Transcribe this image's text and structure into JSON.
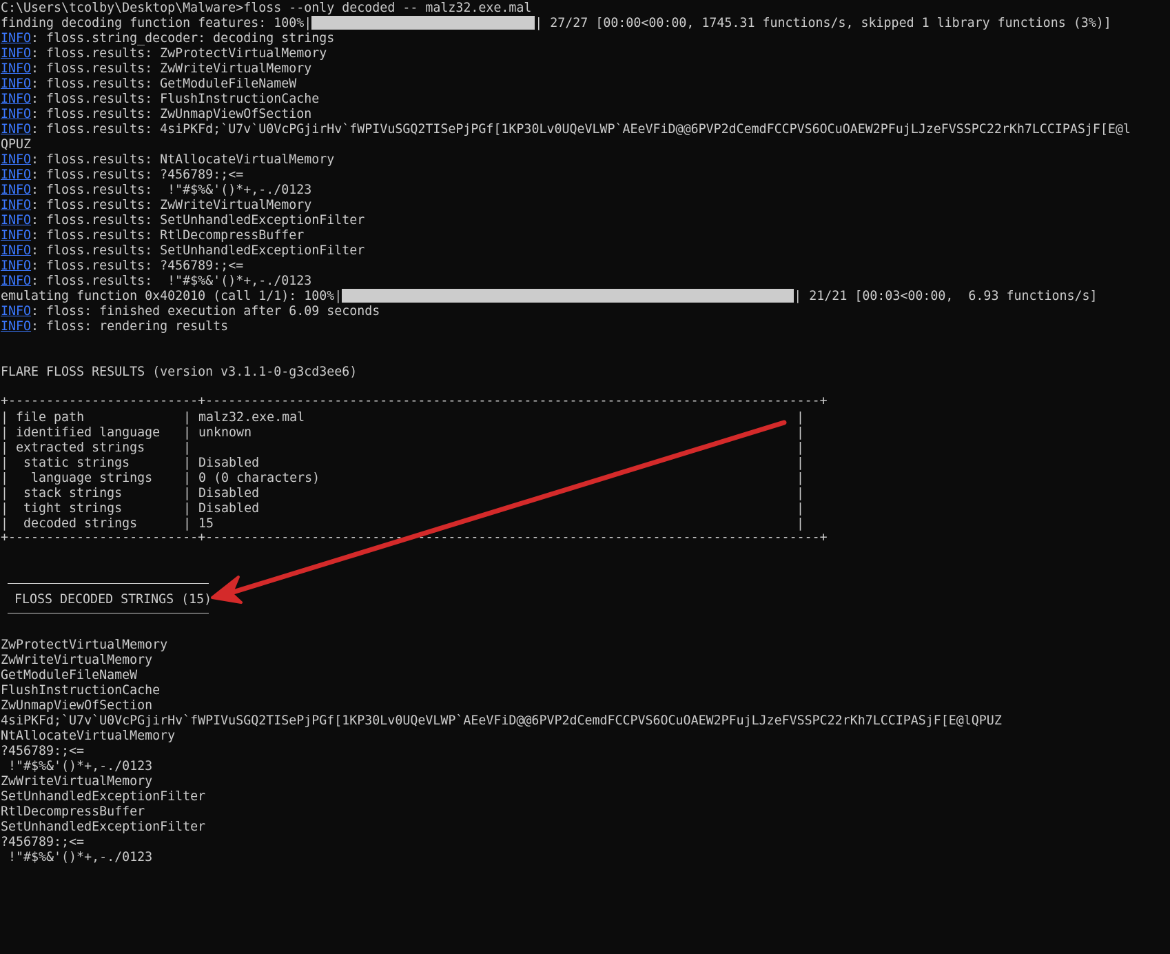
{
  "command_line": "C:\\Users\\tcolby\\Desktop\\Malware>floss --only decoded -- malz32.exe.mal",
  "progress1": {
    "prefix": "finding decoding function features: 100%|",
    "percent": 100,
    "suffix": "| 27/27 [00:00<00:00, 1745.31 functions/s, skipped 1 library functions (3%)]"
  },
  "info_tag": "INFO",
  "log_lines": [
    ": floss.string_decoder: decoding strings",
    ": floss.results: ZwProtectVirtualMemory",
    ": floss.results: ZwWriteVirtualMemory",
    ": floss.results: GetModuleFileNameW",
    ": floss.results: FlushInstructionCache",
    ": floss.results: ZwUnmapViewOfSection",
    ": floss.results: 4siPKFd;`U7v`U0VcPGjirHv`fWPIVuSGQ2TISePjPGf[1KP30Lv0UQeVLWP`AEeVFiD@@6PVP2dCemdFCCPVS6OCuOAEW2PFujLJzeFVSSPC22rKh7LCCIPASjF[E@l",
    ": floss.results: NtAllocateVirtualMemory",
    ": floss.results: ?456789:;<=",
    ": floss.results:  !\"#$%&'()*+,-./0123",
    ": floss.results: ZwWriteVirtualMemory",
    ": floss.results: SetUnhandledExceptionFilter",
    ": floss.results: RtlDecompressBuffer",
    ": floss.results: SetUnhandledExceptionFilter",
    ": floss.results: ?456789:;<=",
    ": floss.results:  !\"#$%&'()*+,-./0123"
  ],
  "wrapped_line": "QPUZ",
  "progress2": {
    "prefix": "emulating function 0x402010 (call 1/1): 100%|",
    "percent": 100,
    "suffix": "| 21/21 [00:03<00:00,  6.93 functions/s]"
  },
  "finish_lines": [
    ": floss: finished execution after 6.09 seconds",
    ": floss: rendering results"
  ],
  "results_header": "FLARE FLOSS RESULTS (version v3.1.1-0-g3cd3ee6)",
  "summary_table": {
    "rows": [
      {
        "label": "file path",
        "value": "malz32.exe.mal"
      },
      {
        "label": "identified language",
        "value": "unknown"
      },
      {
        "label": "extracted strings",
        "value": ""
      },
      {
        "label": " static strings",
        "value": "Disabled"
      },
      {
        "label": "  language strings",
        "value": "0 (0 characters)"
      },
      {
        "label": " stack strings",
        "value": "Disabled"
      },
      {
        "label": " tight strings",
        "value": "Disabled"
      },
      {
        "label": " decoded strings",
        "value": "15"
      }
    ]
  },
  "decoded_heading": "FLOSS DECODED STRINGS (15)",
  "decoded_strings": [
    "ZwProtectVirtualMemory",
    "ZwWriteVirtualMemory",
    "GetModuleFileNameW",
    "FlushInstructionCache",
    "ZwUnmapViewOfSection",
    "4siPKFd;`U7v`U0VcPGjirHv`fWPIVuSGQ2TISePjPGf[1KP30Lv0UQeVLWP`AEeVFiD@@6PVP2dCemdFCCPVS6OCuOAEW2PFujLJzeFVSSPC22rKh7LCCIPASjF[E@lQPUZ",
    "NtAllocateVirtualMemory",
    "?456789:;<=",
    " !\"#$%&'()*+,-./0123",
    "ZwWriteVirtualMemory",
    "SetUnhandledExceptionFilter",
    "RtlDecompressBuffer",
    "SetUnhandledExceptionFilter",
    "?456789:;<=",
    " !\"#$%&'()*+,-./0123"
  ],
  "colors": {
    "background": "#0c0c0c",
    "text": "#cccccc",
    "info_link": "#3b78ff",
    "arrow": "#d42a2a"
  }
}
